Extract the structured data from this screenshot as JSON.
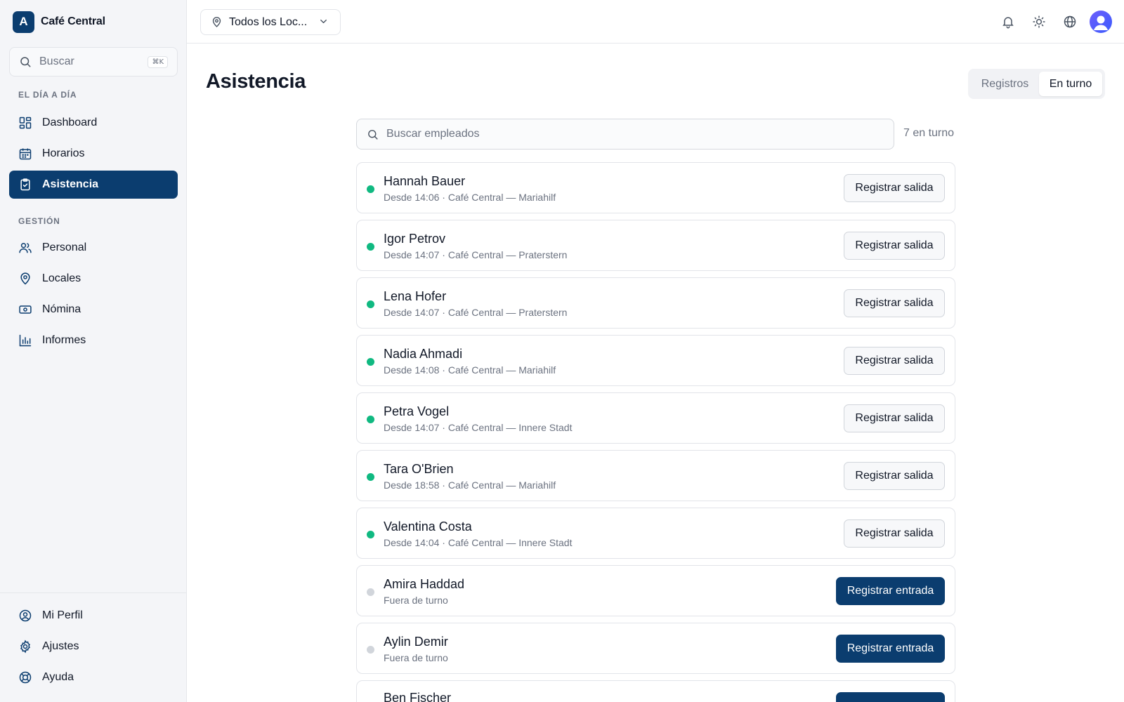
{
  "brand": {
    "initial": "A",
    "name": "Café Central"
  },
  "sidebar": {
    "search_label": "Buscar",
    "search_shortcut": "⌘K",
    "section_day": "EL DÍA A DÍA",
    "section_manage": "GESTIÓN",
    "items": [
      {
        "label": "Dashboard",
        "icon": "dashboard-icon"
      },
      {
        "label": "Horarios",
        "icon": "calendar-icon"
      },
      {
        "label": "Asistencia",
        "icon": "clipboard-check-icon",
        "active": true
      },
      {
        "label": "Personal",
        "icon": "users-icon"
      },
      {
        "label": "Locales",
        "icon": "map-pin-icon"
      },
      {
        "label": "Nómina",
        "icon": "banknote-icon"
      },
      {
        "label": "Informes",
        "icon": "bar-chart-icon"
      }
    ],
    "bottom": [
      {
        "label": "Mi Perfil",
        "icon": "user-circle-icon"
      },
      {
        "label": "Ajustes",
        "icon": "gear-icon"
      },
      {
        "label": "Ayuda",
        "icon": "life-buoy-icon"
      }
    ]
  },
  "topbar": {
    "location": "Todos los Loc...",
    "icons": [
      "bell-icon",
      "sun-icon",
      "globe-icon",
      "avatar"
    ]
  },
  "main": {
    "title": "Asistencia",
    "tabs": [
      {
        "label": "Registros",
        "active": false
      },
      {
        "label": "En turno",
        "active": true
      }
    ],
    "search_placeholder": "Buscar empleados",
    "count_label": "7 en turno",
    "employees": [
      {
        "name": "Hannah Bauer",
        "detail": "Desde 14:06 · Café Central — Mariahilf",
        "on_shift": true,
        "action": "Registrar salida"
      },
      {
        "name": "Igor Petrov",
        "detail": "Desde 14:07 · Café Central — Praterstern",
        "on_shift": true,
        "action": "Registrar salida"
      },
      {
        "name": "Lena Hofer",
        "detail": "Desde 14:07 · Café Central — Praterstern",
        "on_shift": true,
        "action": "Registrar salida"
      },
      {
        "name": "Nadia Ahmadi",
        "detail": "Desde 14:08 · Café Central — Mariahilf",
        "on_shift": true,
        "action": "Registrar salida"
      },
      {
        "name": "Petra Vogel",
        "detail": "Desde 14:07 · Café Central — Innere Stadt",
        "on_shift": true,
        "action": "Registrar salida"
      },
      {
        "name": "Tara O'Brien",
        "detail": "Desde 18:58 · Café Central — Mariahilf",
        "on_shift": true,
        "action": "Registrar salida"
      },
      {
        "name": "Valentina Costa",
        "detail": "Desde 14:04 · Café Central — Innere Stadt",
        "on_shift": true,
        "action": "Registrar salida"
      },
      {
        "name": "Amira Haddad",
        "detail": "Fuera de turno",
        "on_shift": false,
        "action": "Registrar entrada"
      },
      {
        "name": "Aylin Demir",
        "detail": "Fuera de turno",
        "on_shift": false,
        "action": "Registrar entrada"
      },
      {
        "name": "Ben Fischer",
        "detail": "",
        "on_shift": false,
        "action": ""
      }
    ]
  },
  "colors": {
    "brand": "#0b3d6f",
    "on_shift": "#10b981",
    "off_shift": "#d1d5db"
  }
}
